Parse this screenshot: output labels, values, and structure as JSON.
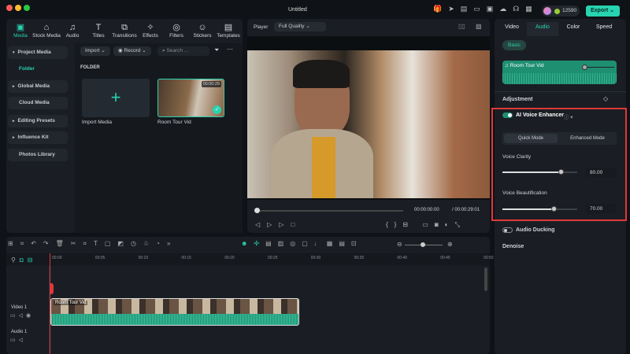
{
  "window": {
    "title": "Untitled",
    "credits": "12590",
    "export_label": "Export"
  },
  "media_tabs": [
    {
      "label": "Media",
      "icon": "media-icon",
      "glyph": "▣"
    },
    {
      "label": "Stock Media",
      "icon": "stock-media-icon",
      "glyph": "⌂"
    },
    {
      "label": "Audio",
      "icon": "music-icon",
      "glyph": "♫"
    },
    {
      "label": "Titles",
      "icon": "titles-icon",
      "glyph": "T"
    },
    {
      "label": "Transitions",
      "icon": "transitions-icon",
      "glyph": "⧉"
    },
    {
      "label": "Effects",
      "icon": "effects-icon",
      "glyph": "✧"
    },
    {
      "label": "Filters",
      "icon": "filters-icon",
      "glyph": "◎"
    },
    {
      "label": "Stickers",
      "icon": "stickers-icon",
      "glyph": "☺"
    },
    {
      "label": "Templates",
      "icon": "templates-icon",
      "glyph": "▤"
    }
  ],
  "sidebar": {
    "items": [
      {
        "label": "Project Media",
        "arrow": "▾"
      },
      {
        "label": "Folder"
      },
      {
        "label": "Global Media",
        "arrow": "▸"
      },
      {
        "label": "Cloud Media"
      },
      {
        "label": "Editing Presets",
        "arrow": "▸"
      },
      {
        "label": "Influence Kit",
        "arrow": "▸"
      },
      {
        "label": "Photos Library"
      }
    ]
  },
  "media_toolbar": {
    "import_label": "Import",
    "record_label": "Record",
    "search_placeholder": "Search ..."
  },
  "media": {
    "section_label": "FOLDER",
    "import_label": "Import Media",
    "clip_name": "Room Tour Vid",
    "clip_duration": "00:00:29"
  },
  "player": {
    "label": "Player",
    "quality": "Full Quality",
    "current_time": "00:00:00:00",
    "total_time": "/ 00:00:29:01"
  },
  "right_panel": {
    "tabs": [
      "Video",
      "Audio",
      "Color",
      "Speed"
    ],
    "active_tab": "Audio",
    "subtab": "Basic",
    "clip_name": "Room Tour Vid",
    "adjustment_label": "Adjustment",
    "enhancer": {
      "label": "AI Voice Enhancer",
      "enabled": true,
      "modes": [
        "Quick Mode",
        "Enhanced Mode"
      ],
      "active_mode": "Quick Mode",
      "voice_clarity": {
        "label": "Voice Clarity",
        "value": "80.00",
        "level": 80
      },
      "voice_beautification": {
        "label": "Voice Beautification",
        "value": "70.00",
        "level": 70
      }
    },
    "ducking_label": "Audio Ducking",
    "ducking_enabled": false,
    "denoise_label": "Denoise"
  },
  "timeline": {
    "ticks": [
      "00:00",
      "00:05",
      "00:10",
      "00:15",
      "00:20",
      "00:25",
      "00:30",
      "00:35",
      "00:40",
      "00:45",
      "00:50"
    ],
    "video_track": "Video 1",
    "audio_track": "Audio 1",
    "clip_label": "Room Tour Vid"
  },
  "colors": {
    "accent": "#27d3b0",
    "highlight": "#e0383a",
    "waveform": "#1f8f72"
  }
}
